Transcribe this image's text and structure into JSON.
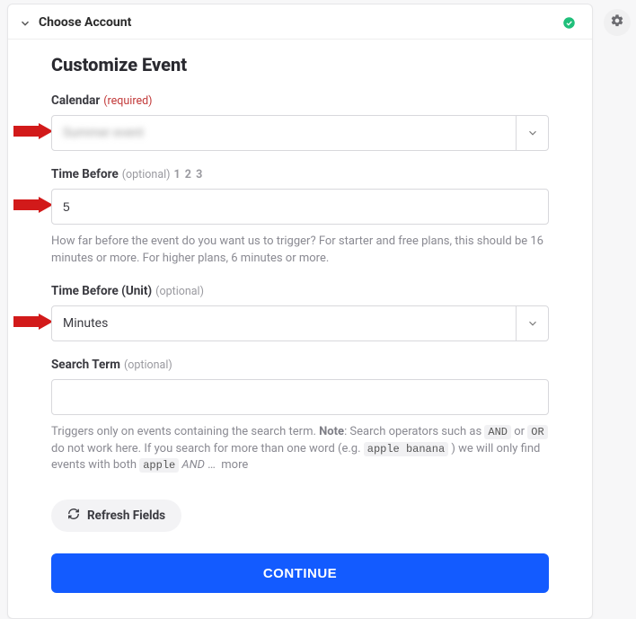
{
  "header": {
    "choose_account": "Choose Account",
    "section_title": "Customize Event"
  },
  "calendar": {
    "label": "Calendar",
    "required_text": "(required)",
    "value": "Summer event"
  },
  "time_before": {
    "label": "Time Before",
    "optional_text": "(optional)",
    "sample": "1 2 3",
    "value": "5",
    "help": "How far before the event do you want us to trigger? For starter and free plans, this should be 16 minutes or more. For higher plans, 6 minutes or more."
  },
  "time_before_unit": {
    "label": "Time Before (Unit)",
    "optional_text": "(optional)",
    "value": "Minutes"
  },
  "search_term": {
    "label": "Search Term",
    "optional_text": "(optional)",
    "value": "",
    "help_pre": "Triggers only on events containing the search term. ",
    "help_note_label": "Note",
    "help_post1": ": Search operators such as ",
    "code_and": "AND",
    "mid_or": " or ",
    "code_or": "OR",
    "help_post2": " do not work here. If you search for more than one word (e.g. ",
    "code_ab": "apple banana",
    "help_post3": " ) we will only find events with both ",
    "code_apple": "apple",
    "em_and": " AND ",
    "ellipsis": "…",
    "more": "more"
  },
  "actions": {
    "refresh": "Refresh Fields",
    "continue": "CONTINUE"
  }
}
